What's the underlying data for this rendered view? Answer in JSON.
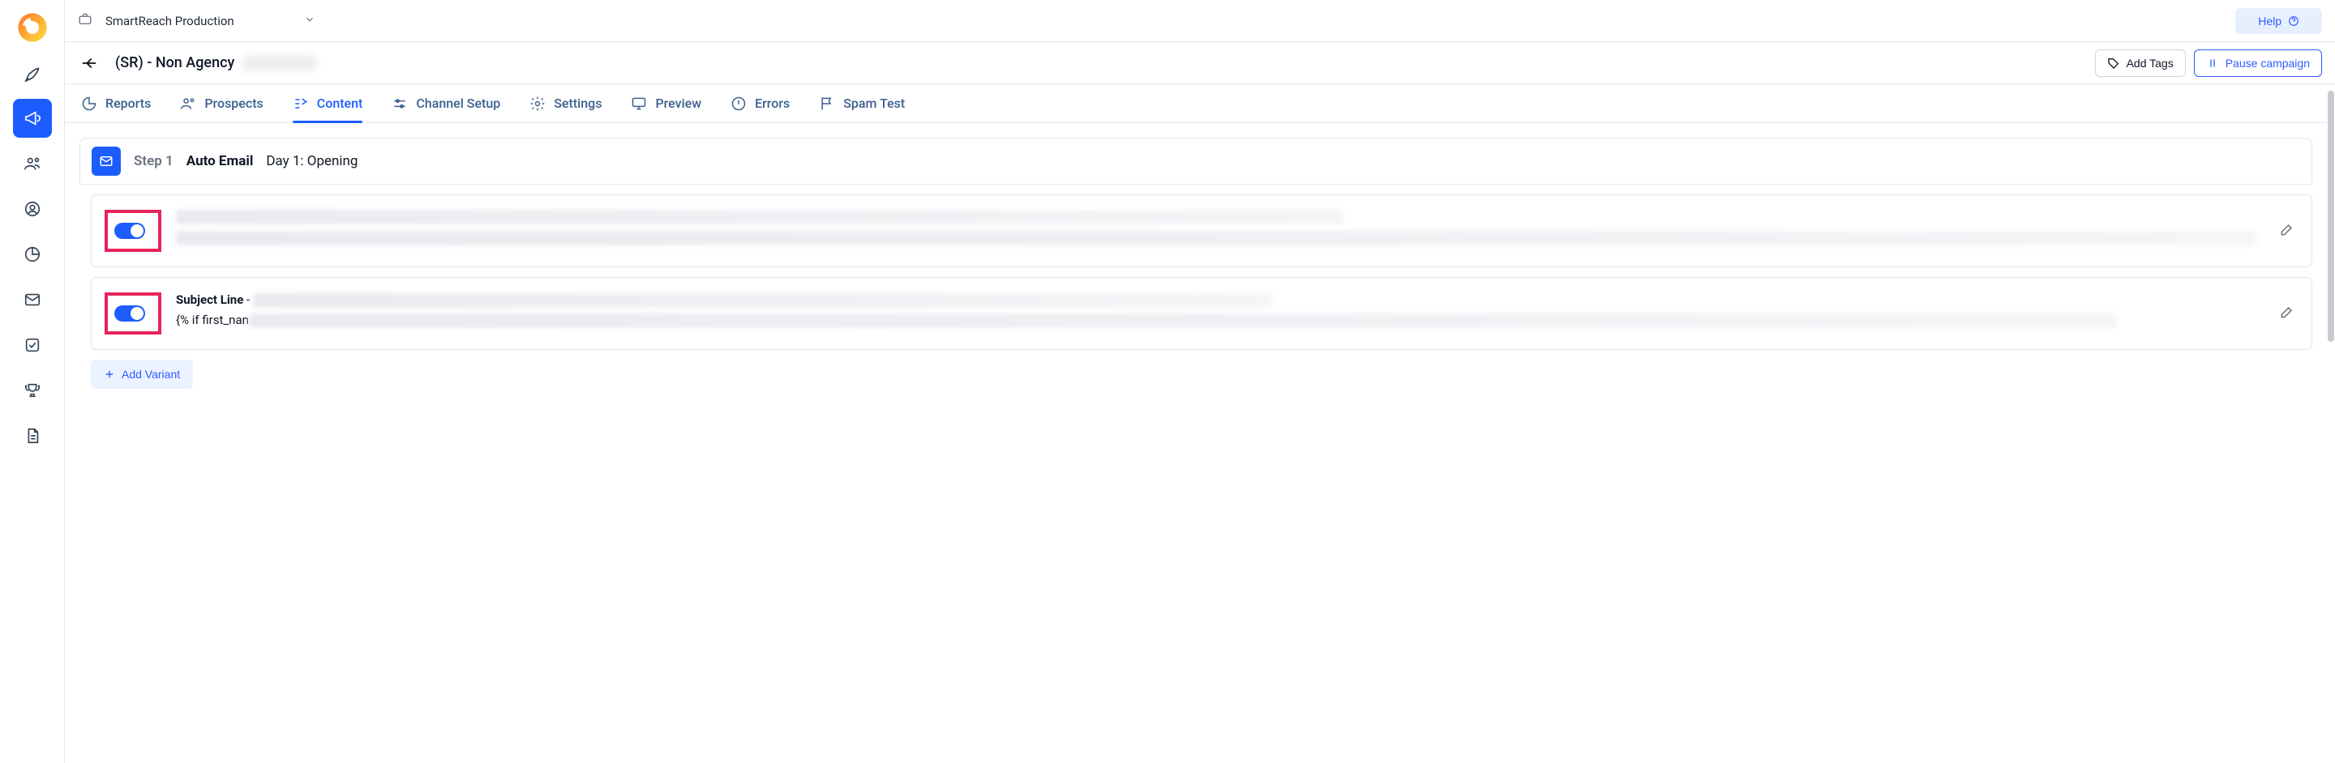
{
  "workspace": {
    "name": "SmartReach Production"
  },
  "help_button": {
    "label": "Help"
  },
  "header": {
    "campaign_title": "(SR) - Non Agency",
    "add_tags_label": "Add Tags",
    "pause_label": "Pause campaign"
  },
  "tabs": {
    "reports": "Reports",
    "prospects": "Prospects",
    "content": "Content",
    "channel_setup": "Channel Setup",
    "settings": "Settings",
    "preview": "Preview",
    "errors": "Errors",
    "spam_test": "Spam Test"
  },
  "step": {
    "label": "Step 1",
    "kind": "Auto Email",
    "day": "Day 1: Opening"
  },
  "variants": {
    "b": {
      "subject_prefix": "Subject Line",
      "snippet_prefix": "{% if first_nan"
    },
    "add_label": "Add Variant"
  }
}
